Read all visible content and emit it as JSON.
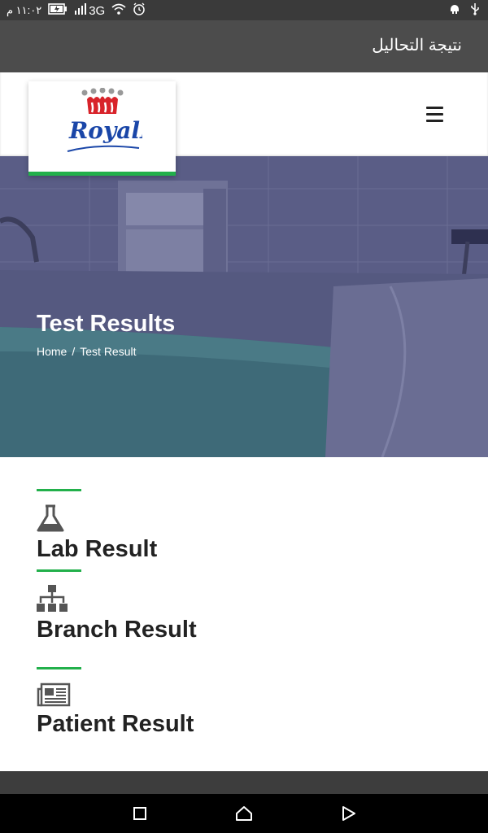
{
  "status_bar": {
    "time": "١١:٠٢ م",
    "network": "3G",
    "icons": [
      "battery-icon",
      "signal-icon",
      "wifi-icon",
      "alarm-icon",
      "android-icon",
      "usb-icon"
    ]
  },
  "app_bar": {
    "title": "نتيجة التحاليل"
  },
  "header": {
    "logo_text": "RoyalLab"
  },
  "hero": {
    "title": "Test Results",
    "breadcrumb": {
      "home": "Home",
      "separator": "/",
      "current": "Test Result"
    }
  },
  "results": [
    {
      "label": "Lab Result",
      "icon": "flask-icon"
    },
    {
      "label": "Branch Result",
      "icon": "sitemap-icon"
    },
    {
      "label": "Patient Result",
      "icon": "newspaper-icon"
    }
  ],
  "colors": {
    "accent": "#22b04b",
    "app_bar": "#4c4c4c",
    "hero_overlay": "#4d5077"
  }
}
